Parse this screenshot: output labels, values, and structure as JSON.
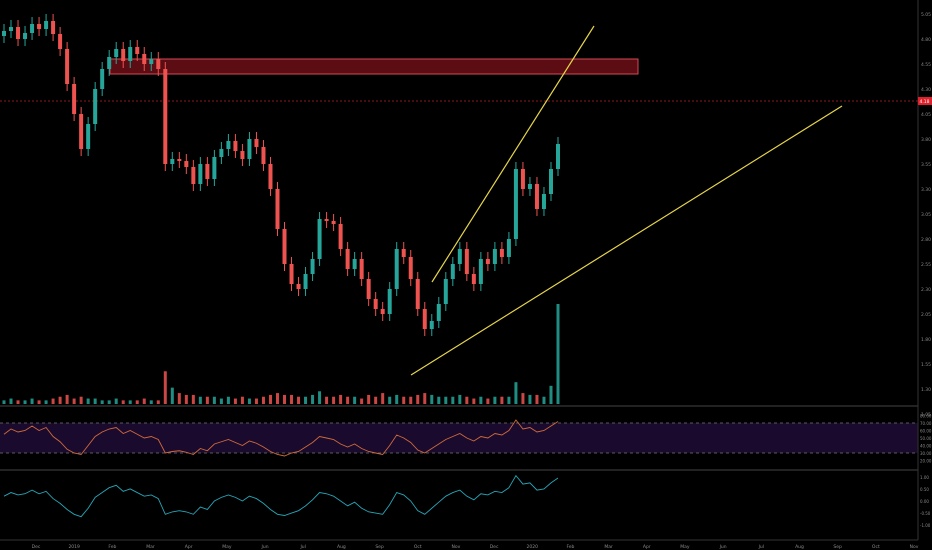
{
  "theme": {
    "background": "#000000",
    "candle_up": "#26a69a",
    "candle_down": "#ef5350",
    "trendline": "#e6d54a",
    "resistance_fill": "#5c0d14",
    "resistance_border": "#d24a55",
    "price_line": "#c0202a",
    "rsi_band": "#1a0a2e",
    "rsi_line": "#d06a3a",
    "osc_line": "#26a6b8",
    "axis_text": "#8a8a8a",
    "price_marker": "#e0202a"
  },
  "chart_data": {
    "type": "candlestick",
    "title": "",
    "price_axis_ticks": [
      "5.05",
      "4.80",
      "4.55",
      "4.30",
      "4.05",
      "3.80",
      "3.55",
      "3.30",
      "3.05",
      "2.80",
      "2.55",
      "2.30",
      "2.05",
      "1.80",
      "1.55",
      "1.30",
      "1.05"
    ],
    "price_range": [
      1.15,
      5.15
    ],
    "last_price_marker": "4.18",
    "time_axis_labels": [
      "Dec",
      "2019",
      "Feb",
      "Mar",
      "Apr",
      "May",
      "Jun",
      "Jul",
      "Aug",
      "Sep",
      "Oct",
      "Nov",
      "Dec",
      "2020",
      "Feb",
      "Mar",
      "Apr",
      "May",
      "Jun",
      "Jul",
      "Aug",
      "Sep",
      "Oct",
      "Nov"
    ],
    "resistance_zone": {
      "top": 4.6,
      "bottom": 4.45
    },
    "candles_close": [
      4.88,
      4.92,
      4.8,
      4.86,
      4.95,
      4.9,
      4.98,
      4.85,
      4.7,
      4.35,
      4.05,
      3.7,
      3.95,
      4.3,
      4.5,
      4.62,
      4.7,
      4.58,
      4.72,
      4.65,
      4.55,
      4.6,
      4.5,
      3.55,
      3.6,
      3.58,
      3.52,
      3.35,
      3.55,
      3.4,
      3.62,
      3.7,
      3.78,
      3.68,
      3.6,
      3.8,
      3.72,
      3.55,
      3.3,
      2.9,
      2.55,
      2.35,
      2.3,
      2.45,
      2.6,
      3.0,
      2.98,
      2.95,
      2.7,
      2.5,
      2.6,
      2.4,
      2.2,
      2.1,
      2.05,
      2.3,
      2.7,
      2.62,
      2.4,
      2.1,
      1.9,
      1.98,
      2.15,
      2.4,
      2.55,
      2.7,
      2.45,
      2.35,
      2.6,
      2.55,
      2.7,
      2.62,
      2.8,
      3.5,
      3.3,
      3.35,
      3.1,
      3.25,
      3.5,
      3.75
    ],
    "rsi_ticks": [
      "80.00",
      "70.00",
      "60.00",
      "50.00",
      "40.00",
      "30.00",
      "20.00"
    ],
    "rsi_range": [
      10,
      90
    ],
    "rsi_upper_band": 70,
    "rsi_lower_band": 30,
    "rsi_values": [
      55,
      62,
      58,
      60,
      66,
      60,
      64,
      52,
      45,
      35,
      30,
      28,
      40,
      52,
      58,
      62,
      64,
      56,
      60,
      55,
      50,
      52,
      48,
      30,
      32,
      33,
      31,
      28,
      36,
      33,
      42,
      45,
      48,
      44,
      40,
      46,
      43,
      38,
      32,
      28,
      26,
      30,
      32,
      38,
      44,
      52,
      50,
      48,
      42,
      38,
      42,
      36,
      32,
      30,
      28,
      40,
      54,
      50,
      44,
      34,
      30,
      36,
      42,
      48,
      52,
      56,
      50,
      46,
      52,
      50,
      56,
      54,
      60,
      74,
      62,
      64,
      58,
      60,
      66,
      72
    ],
    "osc_ticks": [
      "1.00",
      "0.50",
      "0.00",
      "-0.50",
      "-1.00"
    ],
    "osc_range": [
      -1.2,
      1.2
    ],
    "osc_values": [
      0.2,
      0.35,
      0.25,
      0.3,
      0.45,
      0.3,
      0.4,
      0.1,
      -0.1,
      -0.35,
      -0.55,
      -0.65,
      -0.3,
      0.15,
      0.35,
      0.55,
      0.65,
      0.4,
      0.5,
      0.35,
      0.2,
      0.25,
      0.1,
      -0.55,
      -0.45,
      -0.4,
      -0.45,
      -0.55,
      -0.25,
      -0.35,
      0.0,
      0.15,
      0.25,
      0.15,
      0.0,
      0.2,
      0.1,
      -0.1,
      -0.35,
      -0.55,
      -0.6,
      -0.5,
      -0.4,
      -0.2,
      0.05,
      0.35,
      0.3,
      0.2,
      0.0,
      -0.2,
      -0.05,
      -0.3,
      -0.45,
      -0.5,
      -0.55,
      -0.15,
      0.35,
      0.25,
      0.0,
      -0.4,
      -0.55,
      -0.3,
      -0.05,
      0.2,
      0.35,
      0.45,
      0.2,
      0.05,
      0.3,
      0.25,
      0.4,
      0.35,
      0.55,
      1.05,
      0.7,
      0.75,
      0.45,
      0.5,
      0.75,
      0.95
    ],
    "volume_values": [
      2,
      3,
      2,
      2,
      3,
      2,
      2,
      3,
      4,
      5,
      3,
      4,
      3,
      3,
      2,
      2,
      3,
      2,
      2,
      2,
      3,
      2,
      2,
      18,
      9,
      6,
      5,
      5,
      4,
      4,
      4,
      3,
      4,
      3,
      4,
      3,
      3,
      4,
      5,
      6,
      5,
      5,
      4,
      4,
      5,
      7,
      4,
      4,
      5,
      4,
      4,
      3,
      5,
      4,
      6,
      4,
      5,
      4,
      4,
      5,
      6,
      5,
      4,
      4,
      4,
      5,
      4,
      3,
      4,
      3,
      4,
      4,
      4,
      12,
      6,
      5,
      5,
      4,
      10,
      55
    ]
  }
}
